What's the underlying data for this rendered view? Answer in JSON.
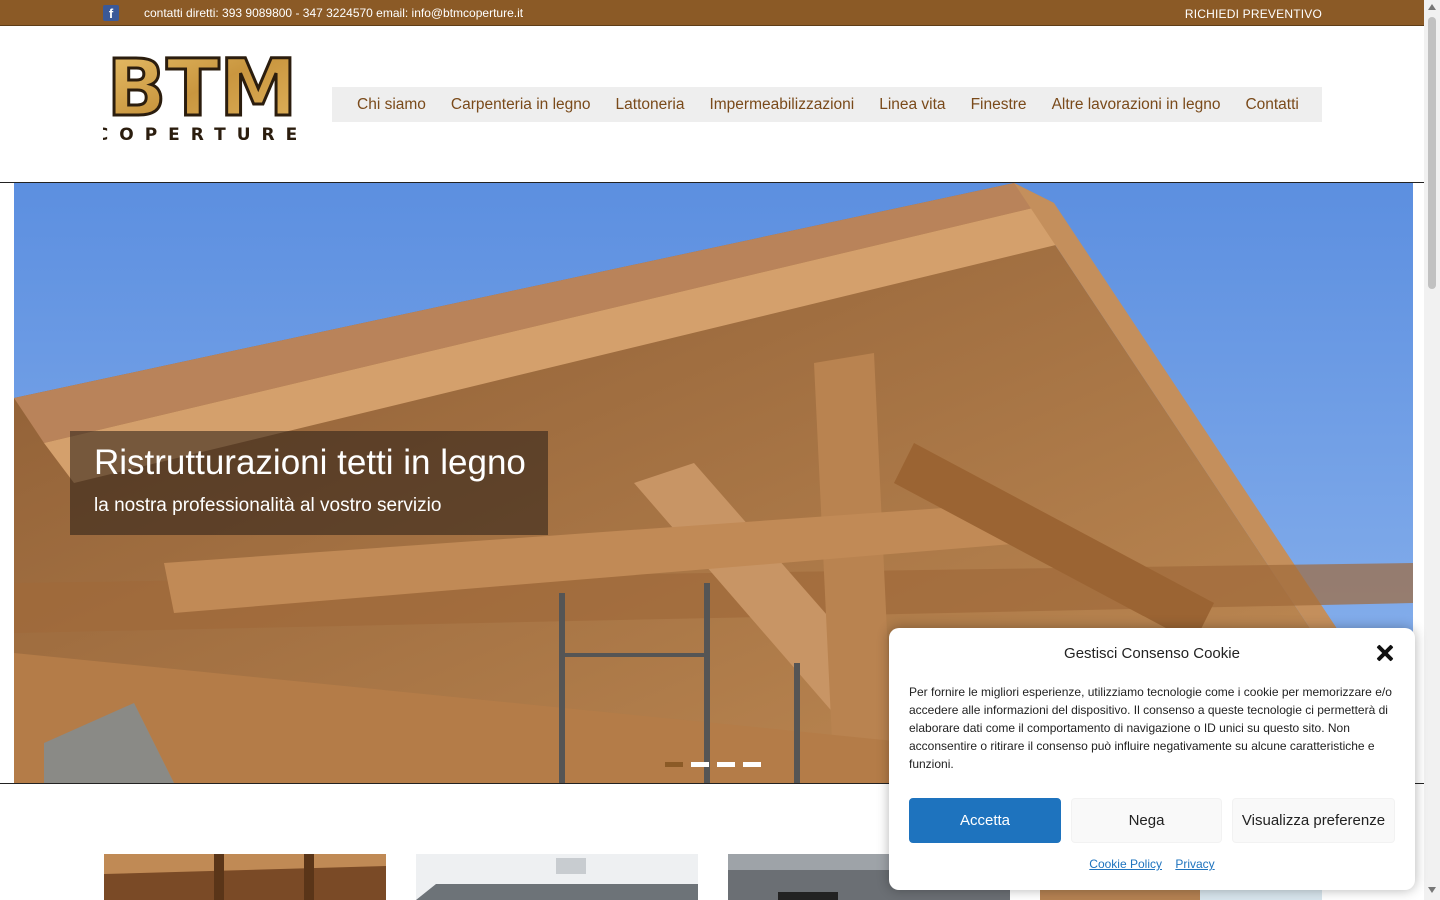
{
  "topbar": {
    "contacts": "contatti diretti: 393 9089800 - 347 3224570 email: info@btmcoperture.it",
    "quote_link": "RICHIEDI PREVENTIVO",
    "facebook_glyph": "f"
  },
  "logo": {
    "letters": "BTM",
    "subtitle": "COPERTURE"
  },
  "nav": {
    "items": [
      {
        "label": "Chi siamo"
      },
      {
        "label": "Carpenteria in legno"
      },
      {
        "label": "Lattoneria"
      },
      {
        "label": "Impermeabilizzazioni"
      },
      {
        "label": "Linea vita"
      },
      {
        "label": "Finestre"
      },
      {
        "label": "Altre lavorazioni in legno"
      },
      {
        "label": "Contatti"
      }
    ]
  },
  "hero": {
    "title": "Ristrutturazioni tetti in legno",
    "subtitle": "la nostra professionalità al vostro servizio",
    "slide_count": 4,
    "active_slide": 1
  },
  "cookie": {
    "title": "Gestisci Consenso Cookie",
    "text": "Per fornire le migliori esperienze, utilizziamo tecnologie come i cookie per memorizzare e/o accedere alle informazioni del dispositivo. Il consenso a queste tecnologie ci permetterà di elaborare dati come il comportamento di navigazione o ID unici su questo sito. Non acconsentire o ritirare il consenso può influire negativamente su alcune caratteristiche e funzioni.",
    "accept_label": "Accetta",
    "deny_label": "Nega",
    "prefs_label": "Visualizza preferenze",
    "cookie_policy_label": "Cookie Policy",
    "privacy_label": "Privacy"
  },
  "colors": {
    "brand_brown": "#8b5a26",
    "nav_text": "#7a4a1a",
    "accept_blue": "#1e73be"
  }
}
